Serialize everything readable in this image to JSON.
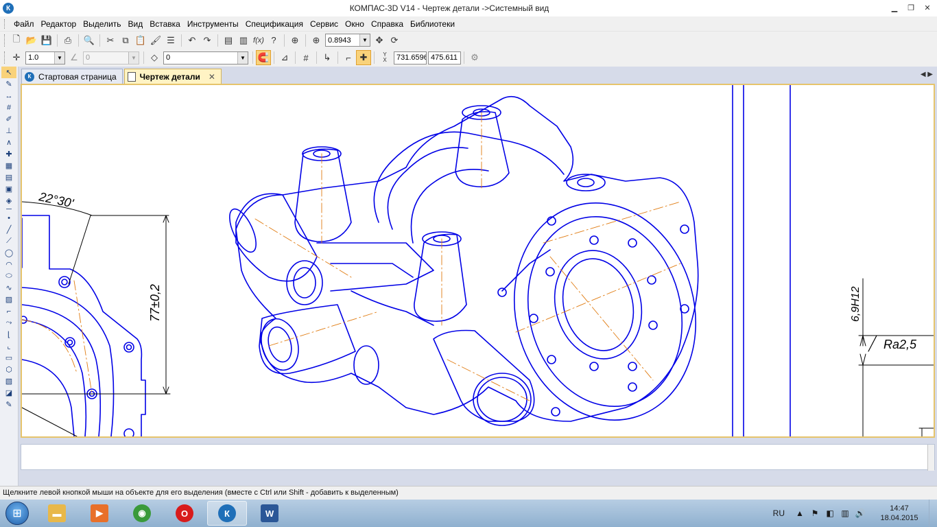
{
  "window": {
    "title": "КОМПАС-3D V14 - Чертеж детали ->Системный вид",
    "logo_letter": "К"
  },
  "menu": [
    "Файл",
    "Редактор",
    "Выделить",
    "Вид",
    "Вставка",
    "Инструменты",
    "Спецификация",
    "Сервис",
    "Окно",
    "Справка",
    "Библиотеки"
  ],
  "toolbar_standard": {
    "zoom_value": "0.8943"
  },
  "toolbar_current_state": {
    "step_value": "1.0",
    "angle_value": "0",
    "layer_value": "0",
    "coord_x": "731.6596",
    "coord_y": "475.611",
    "coord_label": "Y\nX"
  },
  "tabs": [
    {
      "label": "Стартовая страница",
      "active": false
    },
    {
      "label": "Чертеж детали",
      "active": true
    }
  ],
  "drawing": {
    "angle_dimension": "22°30'",
    "linear_dimension": "77±0,2",
    "hole_dimension": "6,9H12",
    "roughness": "Ra2,5"
  },
  "status_text": "Щелкните левой кнопкой мыши на объекте для его выделения (вместе с Ctrl или Shift - добавить к выделенным)",
  "taskbar": {
    "language": "RU",
    "time": "14:47",
    "date": "18.04.2015",
    "apps": [
      {
        "name": "explorer",
        "icon": "folder-icon",
        "color": "#e8b84a"
      },
      {
        "name": "media-player",
        "icon": "play-icon",
        "color": "#e8702a"
      },
      {
        "name": "chrome",
        "icon": "chrome-icon",
        "color": "#3a9a3a"
      },
      {
        "name": "opera",
        "icon": "opera-icon",
        "color": "#d81b1b"
      },
      {
        "name": "kompas",
        "icon": "kompas-icon",
        "color": "#1f6fb8"
      },
      {
        "name": "word",
        "icon": "word-icon",
        "color": "#2b5797"
      }
    ]
  },
  "colors": {
    "drawing_line": "#0000e6",
    "axis_line": "#e07b10",
    "active_tab": "#fff3c4"
  }
}
